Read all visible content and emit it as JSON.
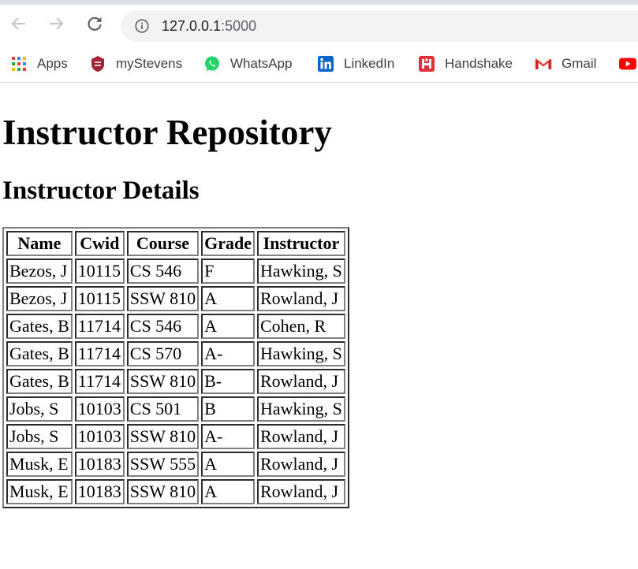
{
  "browser": {
    "address": {
      "host": "127.0.0.1",
      "port": ":5000"
    },
    "bookmarks": [
      {
        "label": "Apps",
        "icon": "apps-grid-icon"
      },
      {
        "label": "myStevens",
        "icon": "stevens-shield-icon"
      },
      {
        "label": "WhatsApp",
        "icon": "whatsapp-icon"
      },
      {
        "label": "LinkedIn",
        "icon": "linkedin-icon"
      },
      {
        "label": "Handshake",
        "icon": "handshake-icon"
      },
      {
        "label": "Gmail",
        "icon": "gmail-icon"
      }
    ]
  },
  "page": {
    "title": "Instructor Repository",
    "subtitle": "Instructor Details"
  },
  "table": {
    "headers": [
      "Name",
      "Cwid",
      "Course",
      "Grade",
      "Instructor"
    ],
    "rows": [
      [
        "Bezos, J",
        "10115",
        "CS 546",
        "F",
        "Hawking, S"
      ],
      [
        "Bezos, J",
        "10115",
        "SSW 810",
        "A",
        "Rowland, J"
      ],
      [
        "Gates, B",
        "11714",
        "CS 546",
        "A",
        "Cohen, R"
      ],
      [
        "Gates, B",
        "11714",
        "CS 570",
        "A-",
        "Hawking, S"
      ],
      [
        "Gates, B",
        "11714",
        "SSW 810",
        "B-",
        "Rowland, J"
      ],
      [
        "Jobs, S",
        "10103",
        "CS 501",
        "B",
        "Hawking, S"
      ],
      [
        "Jobs, S",
        "10103",
        "SSW 810",
        "A-",
        "Rowland, J"
      ],
      [
        "Musk, E",
        "10183",
        "SSW 555",
        "A",
        "Rowland, J"
      ],
      [
        "Musk, E",
        "10183",
        "SSW 810",
        "A",
        "Rowland, J"
      ]
    ]
  },
  "colors": {
    "whatsapp": "#25d366",
    "linkedin": "#0a66c2",
    "handshake": "#e0303a",
    "stevens": "#a32638",
    "gmail": "#ea4335",
    "youtube": "#ff0000"
  }
}
